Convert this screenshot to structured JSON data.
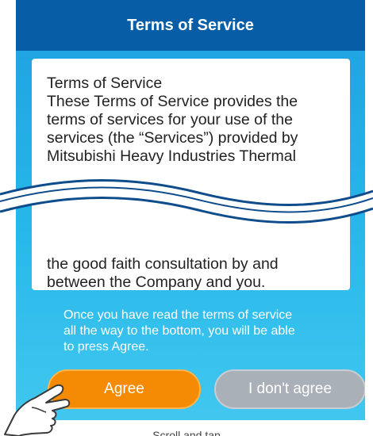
{
  "dialog": {
    "title": "Terms of Service",
    "terms": {
      "top_lines": [
        "Terms of Service",
        "These Terms of Service provides the",
        "terms of services for your use of the",
        "services (the “Services”) provided by",
        "Mitsubishi Heavy Industries Thermal"
      ],
      "bottom_lines": [
        "the good faith consultation by and",
        "between the Company and you."
      ]
    },
    "notice_lines": [
      "Once you have read the terms of service",
      "all the way to the bottom, you will be able",
      "to press Agree."
    ],
    "agree_label": "Agree",
    "disagree_label": "I don't agree"
  },
  "footer_label": "Scroll and tap",
  "icons": {
    "cut_mark": "wavy-cut-icon",
    "pointer": "pointing-hand-icon"
  },
  "colors": {
    "title_bar": "#075ea6",
    "background_top": "#1f9fe0",
    "background_bottom": "#41c7ef",
    "agree_button": "#f58a04",
    "disagree_button": "#a9b0b7"
  }
}
